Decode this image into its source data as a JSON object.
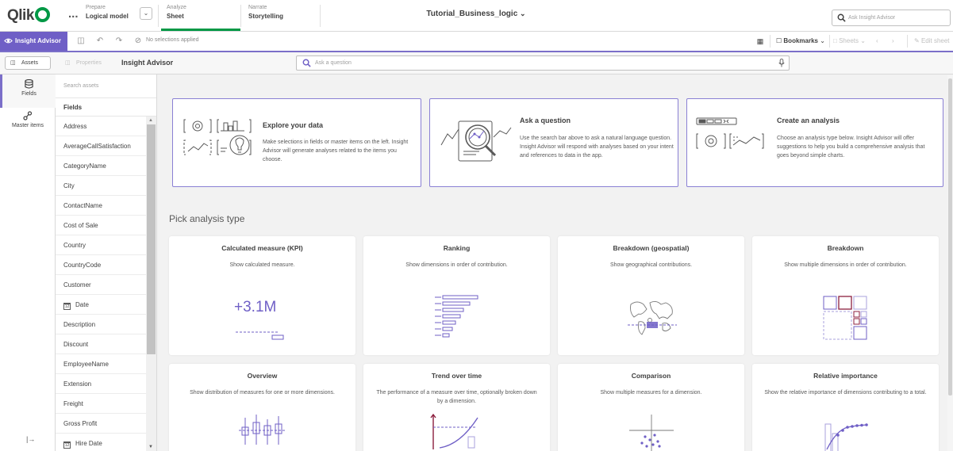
{
  "app": {
    "logo": "Qlik",
    "title": "Tutorial_Business_logic",
    "more_label": "..."
  },
  "nav": {
    "prepare": {
      "small": "Prepare",
      "big": "Logical model"
    },
    "analyze": {
      "small": "Analyze",
      "big": "Sheet"
    },
    "narrate": {
      "small": "Narrate",
      "big": "Storytelling"
    },
    "search_placeholder": "Ask Insight Advisor"
  },
  "toolbar": {
    "insight_advisor": "Insight Advisor",
    "selections": "No selections applied",
    "bookmarks": "Bookmarks",
    "sheets": "Sheets",
    "edit_sheet": "Edit sheet"
  },
  "panel": {
    "assets_tab": "Assets",
    "properties_tab": "Properties",
    "title": "Insight Advisor",
    "ask_placeholder": "Ask a question"
  },
  "leftnav": {
    "fields": "Fields",
    "master_items": "Master items"
  },
  "fields": {
    "search_placeholder": "Search assets",
    "header": "Fields",
    "items": [
      {
        "name": "Address",
        "date": false
      },
      {
        "name": "AverageCallSatisfaction",
        "date": false
      },
      {
        "name": "CategoryName",
        "date": false
      },
      {
        "name": "City",
        "date": false
      },
      {
        "name": "ContactName",
        "date": false
      },
      {
        "name": "Cost of Sale",
        "date": false
      },
      {
        "name": "Country",
        "date": false
      },
      {
        "name": "CountryCode",
        "date": false
      },
      {
        "name": "Customer",
        "date": false
      },
      {
        "name": "Date",
        "date": true
      },
      {
        "name": "Description",
        "date": false
      },
      {
        "name": "Discount",
        "date": false
      },
      {
        "name": "EmployeeName",
        "date": false
      },
      {
        "name": "Extension",
        "date": false
      },
      {
        "name": "Freight",
        "date": false
      },
      {
        "name": "Gross Profit",
        "date": false
      },
      {
        "name": "Hire Date",
        "date": true
      }
    ]
  },
  "info_cards": [
    {
      "title": "Explore your data",
      "desc": "Make selections in fields or master items on the left. Insight Advisor will generate analyses related to the items you choose."
    },
    {
      "title": "Ask a question",
      "desc": "Use the search bar above to ask a natural language question. Insight Advisor will respond with analyses based on your intent and references to data in the app."
    },
    {
      "title": "Create an analysis",
      "desc": "Choose an analysis type below. Insight Advisor will offer suggestions to help you build a comprehensive analysis that goes beyond simple charts."
    }
  ],
  "pick_title": "Pick analysis type",
  "analysis_types": [
    {
      "title": "Calculated measure (KPI)",
      "desc": "Show calculated measure.",
      "kpi": "+3.1M"
    },
    {
      "title": "Ranking",
      "desc": "Show dimensions in order of contribution."
    },
    {
      "title": "Breakdown (geospatial)",
      "desc": "Show geographical contributions."
    },
    {
      "title": "Breakdown",
      "desc": "Show multiple dimensions in order of contribution."
    },
    {
      "title": "Overview",
      "desc": "Show distribution of measures for one or more dimensions."
    },
    {
      "title": "Trend over time",
      "desc": "The performance of a measure over time, optionally broken down by a dimension."
    },
    {
      "title": "Comparison",
      "desc": "Show multiple measures for a dimension."
    },
    {
      "title": "Relative importance",
      "desc": "Show the relative importance of dimensions contributing to a total."
    }
  ],
  "colors": {
    "accent": "#6f5fc6",
    "brand_green": "#009845",
    "border_accent": "#8a80d4"
  },
  "icons": [
    "search-icon",
    "insight-advisor-icon",
    "bookmark-icon",
    "sheets-icon",
    "edit-icon",
    "mic-icon",
    "database-icon",
    "master-items-icon",
    "collapse-icon",
    "calendar-icon"
  ]
}
